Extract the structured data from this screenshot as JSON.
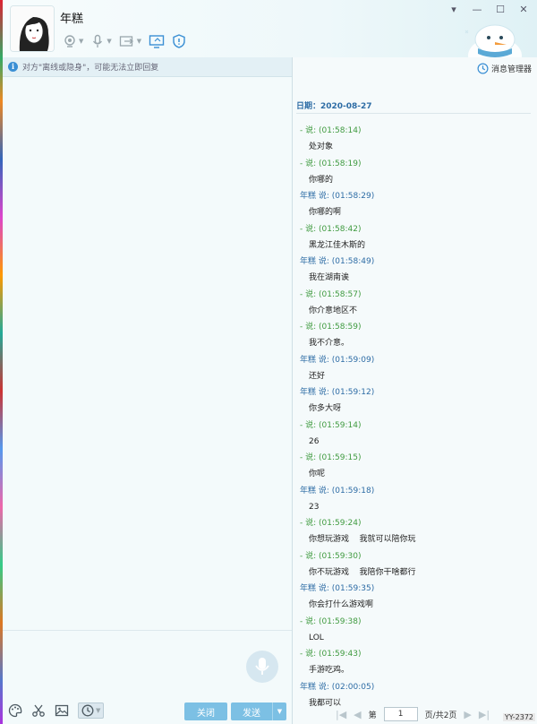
{
  "contact": {
    "name": "年糕"
  },
  "window_controls": {
    "dropdown": "▾",
    "minimize": "—",
    "maximize": "☐",
    "close": "✕"
  },
  "notice": {
    "text": "对方\"离线或隐身\"，可能无法立即回复"
  },
  "history_panel": {
    "message_manager_label": "消息管理器",
    "date_label": "日期：2020-08-27",
    "messages": [
      {
        "sender": "- 说:",
        "time": "(01:58:14)",
        "text": "处对象"
      },
      {
        "sender": "- 说:",
        "time": "(01:58:19)",
        "text": "你哪的"
      },
      {
        "sender": "年糕 说:",
        "time": "(01:58:29)",
        "text": "你哪的啊"
      },
      {
        "sender": "- 说:",
        "time": "(01:58:42)",
        "text": "黑龙江佳木斯的"
      },
      {
        "sender": "年糕 说:",
        "time": "(01:58:49)",
        "text": "我在湖南诶"
      },
      {
        "sender": "- 说:",
        "time": "(01:58:57)",
        "text": "你介意地区不"
      },
      {
        "sender": "- 说:",
        "time": "(01:58:59)",
        "text": "我不介意。"
      },
      {
        "sender": "年糕 说:",
        "time": "(01:59:09)",
        "text": "还好"
      },
      {
        "sender": "年糕 说:",
        "time": "(01:59:12)",
        "text": "你多大呀"
      },
      {
        "sender": "- 说:",
        "time": "(01:59:14)",
        "text": "26"
      },
      {
        "sender": "- 说:",
        "time": "(01:59:15)",
        "text": "你呢"
      },
      {
        "sender": "年糕 说:",
        "time": "(01:59:18)",
        "text": "23"
      },
      {
        "sender": "- 说:",
        "time": "(01:59:24)",
        "text": "你想玩游戏    我就可以陪你玩"
      },
      {
        "sender": "- 说:",
        "time": "(01:59:30)",
        "text": "你不玩游戏    我陪你干啥都行"
      },
      {
        "sender": "年糕 说:",
        "time": "(01:59:35)",
        "text": "你会打什么游戏啊"
      },
      {
        "sender": "- 说:",
        "time": "(01:59:38)",
        "text": "LOL"
      },
      {
        "sender": "- 说:",
        "time": "(01:59:43)",
        "text": "手游吃鸡。"
      },
      {
        "sender": "年糕 说:",
        "time": "(02:00:05)",
        "text": "我都可以"
      }
    ],
    "pager": {
      "first": "|◀",
      "prev": "◀",
      "page_label": "第",
      "page_value": "1",
      "total_label": "页/共2页",
      "next": "▶",
      "last": "▶|"
    }
  },
  "compose": {
    "close_label": "关闭",
    "send_label": "发送",
    "send_dropdown": "▼"
  },
  "watermark": "YY-2372",
  "colors": {
    "accent": "#7cc0e4",
    "self_sender": "#3f9a3f",
    "other_sender": "#2d6ca5"
  }
}
